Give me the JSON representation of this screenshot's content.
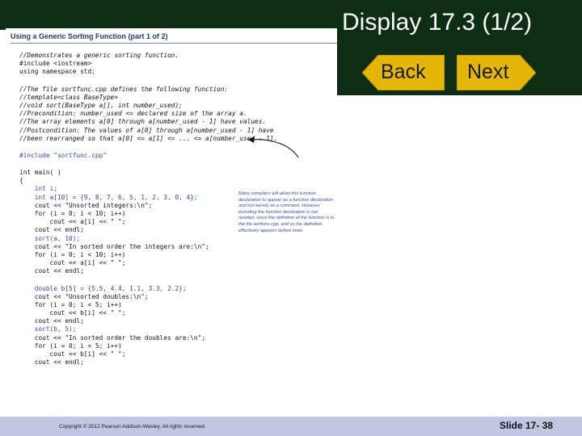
{
  "slide": {
    "title": "Display 17.3 (1/2)",
    "nav": {
      "back_label": "Back",
      "next_label": "Next"
    },
    "footer": {
      "copyright": "Copyright © 2012 Pearson Addison-Wesley. All rights reserved.",
      "slide_number": "Slide 17- 38"
    },
    "colors": {
      "header_bg": "#0d2e12",
      "footer_bg": "#c2c6e2",
      "button": "#e5b60a",
      "highlight_code": "#3444b4"
    }
  },
  "display": {
    "heading": "Using a Generic Sorting Function (part 1 of 2)",
    "code_lines": [
      "//Demonstrates a generic sorting function.",
      "#include <iostream>",
      "using namespace std;",
      "",
      "//The file sortfunc.cpp defines the following function:",
      "//template<class BaseType>",
      "//void sort(BaseType a[], int number_used);",
      "//Precondition: number_used <= declared size of the array a.",
      "//The array elements a[0] through a[number_used - 1] have values.",
      "//Postcondition: The values of a[0] through a[number_used - 1] have",
      "//been rearranged so that a[0] <= a[1] <= ... <= a[number_used - 1].",
      "",
      "#include \"sortfunc.cpp\"",
      "",
      "int main( )",
      "{",
      "    int i;",
      "    int a[10] = {9, 8, 7, 6, 5, 1, 2, 3, 0, 4};",
      "    cout << \"Unsorted integers:\\n\";",
      "    for (i = 0; i < 10; i++)",
      "        cout << a[i] << \" \";",
      "    cout << endl;",
      "    sort(a, 10);",
      "    cout << \"In sorted order the integers are:\\n\";",
      "    for (i = 0; i < 10; i++)",
      "        cout << a[i] << \" \";",
      "    cout << endl;",
      "",
      "    double b[5] = {5.5, 4.4, 1.1, 3.3, 2.2};",
      "    cout << \"Unsorted doubles:\\n\";",
      "    for (i = 0; i < 5; i++)",
      "        cout << b[i] << \" \";",
      "    cout << endl;",
      "    sort(b, 5);",
      "    cout << \"In sorted order the doubles are:\\n\";",
      "    for (i = 0; i < 5; i++)",
      "        cout << b[i] << \" \";",
      "    cout << endl;"
    ],
    "highlighted_lines": [
      12,
      16,
      17,
      22,
      28,
      33
    ],
    "annotation": "Many compilers will allow this function declaration to appear as a function declaration and not merely as a comment. However, including the function declaration is not needed, since the definition of the function is in the file sortfunc.cpp, and so the definition effectively appears before main."
  }
}
